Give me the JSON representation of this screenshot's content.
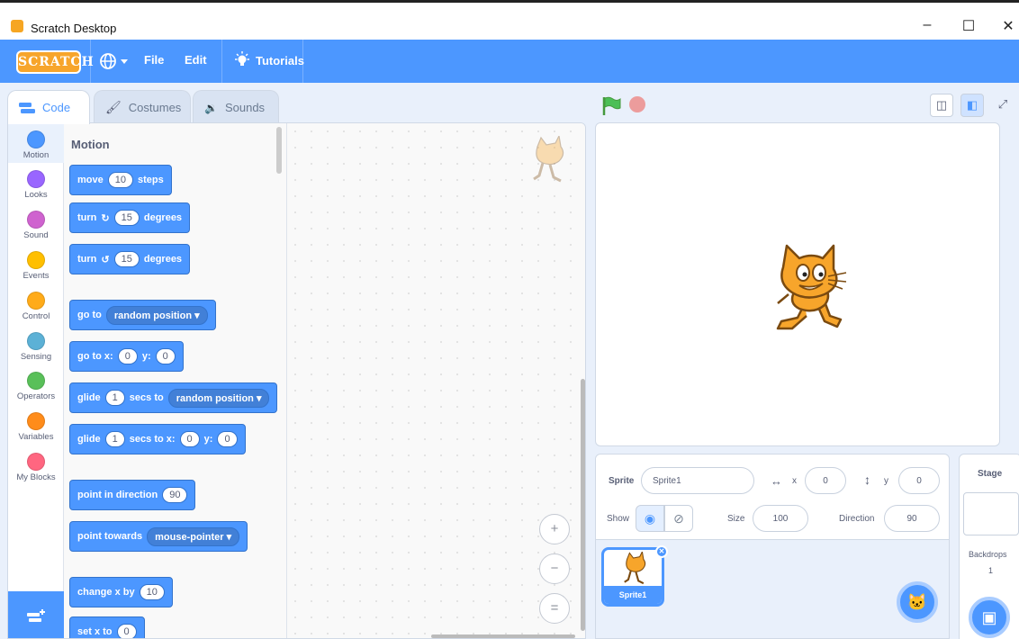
{
  "window": {
    "title": "Scratch Desktop",
    "minimize": "–",
    "maximize": "☐",
    "close": "✕"
  },
  "menu": {
    "logo": "SCRATCH",
    "language_icon": "globe-icon",
    "file": "File",
    "edit": "Edit",
    "tutorials": "Tutorials"
  },
  "tabs": {
    "code": "Code",
    "costumes": "Costumes",
    "sounds": "Sounds"
  },
  "categories": [
    {
      "label": "Motion",
      "color": "#4c97ff"
    },
    {
      "label": "Looks",
      "color": "#9966ff"
    },
    {
      "label": "Sound",
      "color": "#cf63cf"
    },
    {
      "label": "Events",
      "color": "#ffbf00"
    },
    {
      "label": "Control",
      "color": "#ffab19"
    },
    {
      "label": "Sensing",
      "color": "#5cb1d6"
    },
    {
      "label": "Operators",
      "color": "#59c059"
    },
    {
      "label": "Variables",
      "color": "#ff8c1a"
    },
    {
      "label": "My Blocks",
      "color": "#ff6680"
    }
  ],
  "palette": {
    "section": "Motion",
    "move": {
      "a": "move",
      "n": "10",
      "b": "steps"
    },
    "turn_right": {
      "a": "turn",
      "n": "15",
      "b": "degrees"
    },
    "turn_left": {
      "a": "turn",
      "n": "15",
      "b": "degrees"
    },
    "goto": {
      "a": "go to",
      "dd": "random position"
    },
    "gotoxy": {
      "a": "go to x:",
      "x": "0",
      "b": "y:",
      "y": "0"
    },
    "glide_to": {
      "a": "glide",
      "n": "1",
      "b": "secs to",
      "dd": "random position"
    },
    "glide_xy": {
      "a": "glide",
      "n": "1",
      "b": "secs to x:",
      "x": "0",
      "c": "y:",
      "y": "0"
    },
    "point_dir": {
      "a": "point in direction",
      "n": "90"
    },
    "point_towards": {
      "a": "point towards",
      "dd": "mouse-pointer"
    },
    "change_x": {
      "a": "change x by",
      "n": "10"
    },
    "set_x": {
      "a": "set x to",
      "n": "0"
    }
  },
  "zoom": {
    "in": "+",
    "out": "−",
    "reset": "="
  },
  "sprite_info": {
    "sprite_label": "Sprite",
    "sprite_name": "Sprite1",
    "x_label": "x",
    "x": "0",
    "y_label": "y",
    "y": "0",
    "show_label": "Show",
    "size_label": "Size",
    "size": "100",
    "direction_label": "Direction",
    "direction": "90"
  },
  "sprites": [
    {
      "name": "Sprite1"
    }
  ],
  "stage_panel": {
    "title": "Stage",
    "backdrops_label": "Backdrops",
    "backdrops_count": "1"
  }
}
